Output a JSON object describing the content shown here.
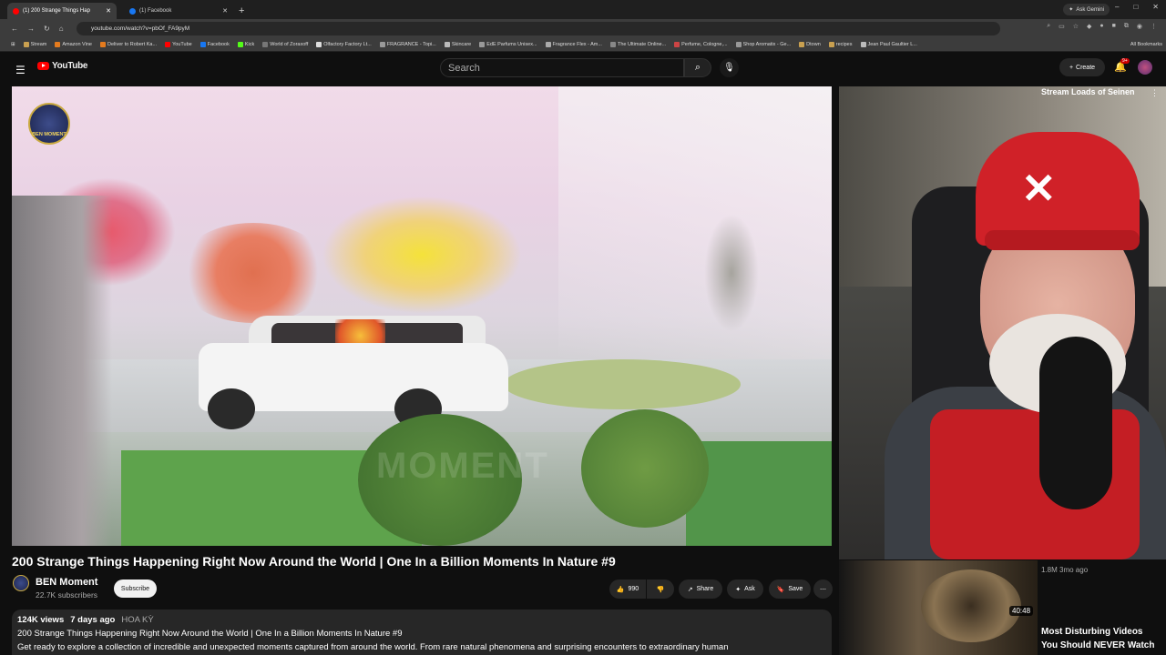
{
  "browser": {
    "tabs": [
      {
        "title": "(1) 200 Strange Things Hap"
      },
      {
        "title": "(1) Facebook"
      }
    ],
    "new_tab": "+",
    "ask_gemini": "Ask Gemini",
    "address": "youtube.com/watch?v=pbOf_FA9pyM",
    "bookmarks": [
      "Stream",
      "Amazon Vine",
      "Deliver to Robert Ka...",
      "YouTube",
      "Facebook",
      "Kick",
      "World of Zoraxoff",
      "Olfactory Factory Lt...",
      "FRAGRANCE - Topi...",
      "Skincare",
      "EdE Parfums Unisex...",
      "Fragrance Flex - Am...",
      "The Ultimate Online...",
      "Perfume, Cologne,...",
      "Shop Aromatix - Ge...",
      "Dtown",
      "recipes",
      "Jean Paul Gaultier L..."
    ],
    "all_bookmarks": "All Bookmarks"
  },
  "header": {
    "logo": "YouTube",
    "search_placeholder": "Search",
    "create": "Create",
    "notif_count": "9+"
  },
  "player": {
    "channel_badge": "BEN MOMENT",
    "watermark": "MOMENT"
  },
  "video": {
    "title": "200 Strange Things Happening Right Now Around the World | One In a Billion Moments In Nature #9",
    "channel": "BEN Moment",
    "subscribers": "22.7K subscribers",
    "subscribe": "Subscribe",
    "likes": "990",
    "share": "Share",
    "ask": "Ask",
    "save": "Save",
    "views": "124K views",
    "age": "7 days ago",
    "tag": "HOA KỲ",
    "desc_line1": "200 Strange Things Happening Right Now Around the World | One In a Billion Moments In Nature #9",
    "desc_line2": "Get ready to explore a collection of incredible and unexpected moments captured from around the world. From rare natural phenomena and surprising encounters to extraordinary human"
  },
  "sidebar": {
    "top_title": "Stream Loads of Seinen",
    "item_a_meta": "1.8M  3mo ago",
    "item_b_duration": "40:48",
    "item_b_title1": "Most Disturbing Videos",
    "item_b_title2": "You Should NEVER Watch"
  }
}
